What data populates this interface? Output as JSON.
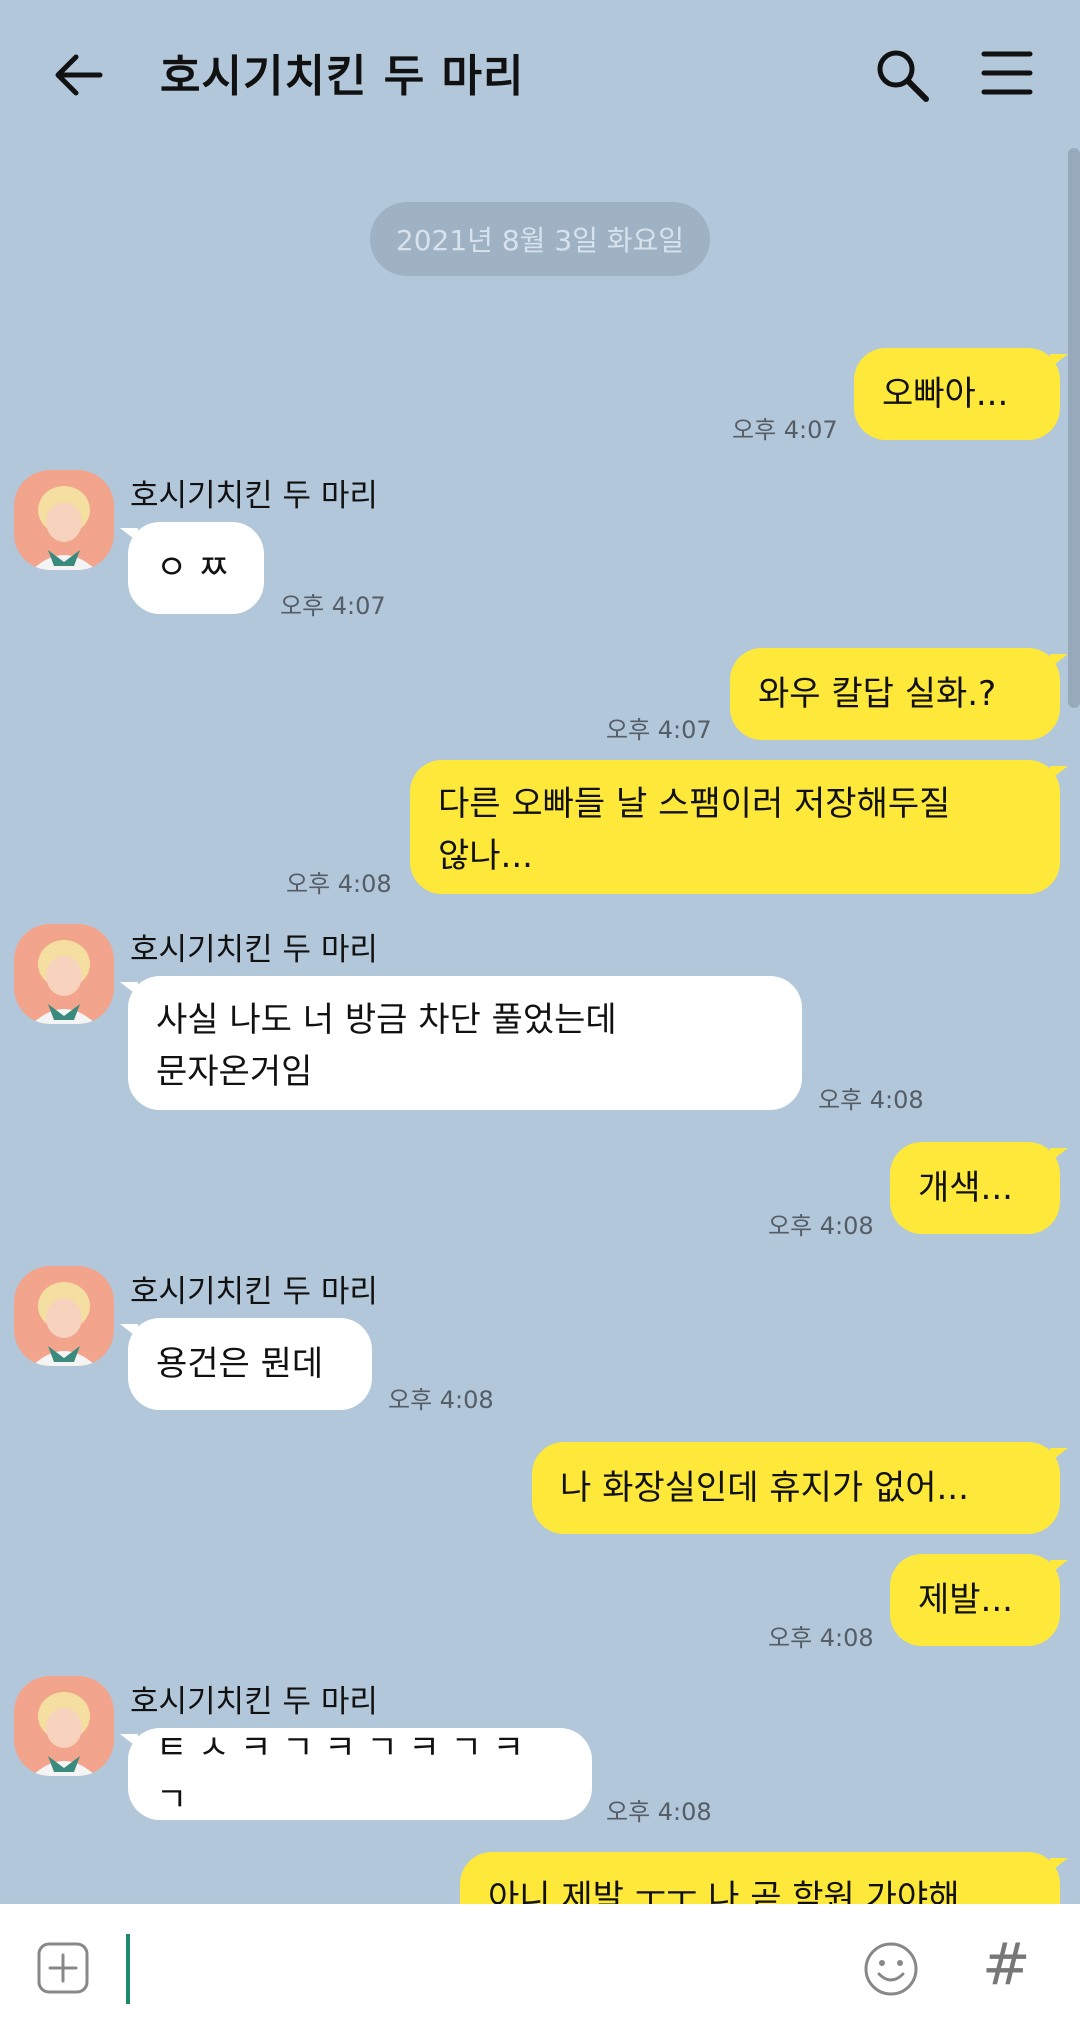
{
  "header": {
    "title": "호시기치킨 두 마리"
  },
  "date_divider": "2021년 8월 3일 화요일",
  "sender_name": "호시기치킨 두 마리",
  "messages": [
    {
      "text": "오빠아...",
      "time": "오후 4:07"
    },
    {
      "text": "ㅇ ㅉ",
      "time": "오후 4:07"
    },
    {
      "text": "와우 칼답 실화.?",
      "time": "오후 4:07"
    },
    {
      "text1": "다른 오빠들 날 스팸이러 저장해두질",
      "text2": "않나...",
      "time": "오후 4:08"
    },
    {
      "text1": "사실 나도 너 방금 차단 풀었는데",
      "text2": "문자온거임",
      "time": "오후 4:08"
    },
    {
      "text": "개색...",
      "time": "오후 4:08"
    },
    {
      "text": "용건은 뭔데",
      "time": "오후 4:08"
    },
    {
      "text": "나 화장실인데 휴지가 없어...",
      "time": ""
    },
    {
      "text": "제발...",
      "time": "오후 4:08"
    },
    {
      "text": "ㅌ ㅅ ㅋ ㄱ ㅋ ㄱ ㅋ ㄱ ㅋ ㄱ",
      "time": "오후 4:08"
    },
    {
      "text": "아니 제발 ㅜㅜ 나 곧 학원 가야해"
    }
  ],
  "colors": {
    "background": "#b2c7da",
    "bubble_out": "#fee93b",
    "bubble_in": "#ffffff",
    "cursor": "#1c8a6a"
  }
}
